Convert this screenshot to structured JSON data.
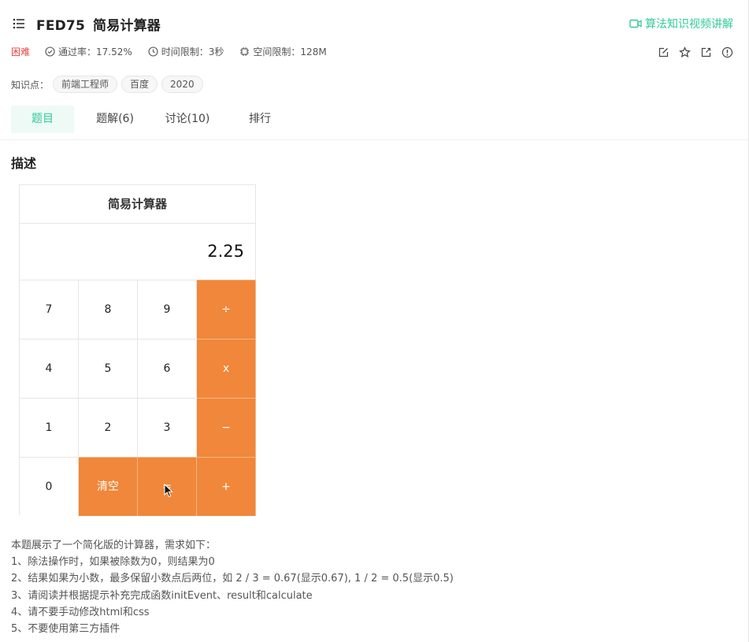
{
  "problem": {
    "code": "FED75",
    "title": "简易计算器",
    "video_link": "算法知识视频讲解",
    "difficulty": "困难",
    "pass_rate": "通过率：17.52%",
    "time_limit": "时间限制：3秒",
    "space_limit": "空间限制：128M",
    "knowledge_label": "知识点：",
    "tags": [
      "前端工程师",
      "百度",
      "2020"
    ]
  },
  "tabs": [
    {
      "label": "题目",
      "active": true
    },
    {
      "label": "题解(6)",
      "active": false
    },
    {
      "label": "讨论(10)",
      "active": false
    },
    {
      "label": "排行",
      "active": false
    }
  ],
  "description": {
    "heading": "描述",
    "calculator": {
      "title": "简易计算器",
      "display": "2.25",
      "keys": [
        {
          "label": "7"
        },
        {
          "label": "8"
        },
        {
          "label": "9"
        },
        {
          "label": "÷",
          "operator": true
        },
        {
          "label": "4"
        },
        {
          "label": "5"
        },
        {
          "label": "6"
        },
        {
          "label": "x",
          "operator": true
        },
        {
          "label": "1"
        },
        {
          "label": "2"
        },
        {
          "label": "3"
        },
        {
          "label": "−",
          "operator": true
        },
        {
          "label": "0"
        },
        {
          "label": "清空",
          "operator": true
        },
        {
          "label": "=",
          "operator": true
        },
        {
          "label": "+",
          "operator": true
        }
      ],
      "operator_color": "#f0873a"
    },
    "requirements": [
      "本题展示了一个简化版的计算器，需求如下：",
      "1、除法操作时，如果被除数为0，则结果为0",
      "2、结果如果为小数，最多保留小数点后两位，如 2 / 3 = 0.67(显示0.67), 1 / 2 = 0.5(显示0.5)",
      "3、请阅读并根据提示补充完成函数initEvent、result和calculate",
      "4、请不要手动修改html和css",
      "5、不要使用第三方插件"
    ]
  },
  "colors": {
    "accent": "#32ca99",
    "difficulty": "#e84444",
    "operator": "#f0873a"
  },
  "icons": [
    "list-icon",
    "video-icon",
    "check-circle-icon",
    "clock-icon",
    "chip-icon",
    "edit-icon",
    "star-icon",
    "share-icon",
    "info-icon",
    "mouse-cursor-icon"
  ]
}
